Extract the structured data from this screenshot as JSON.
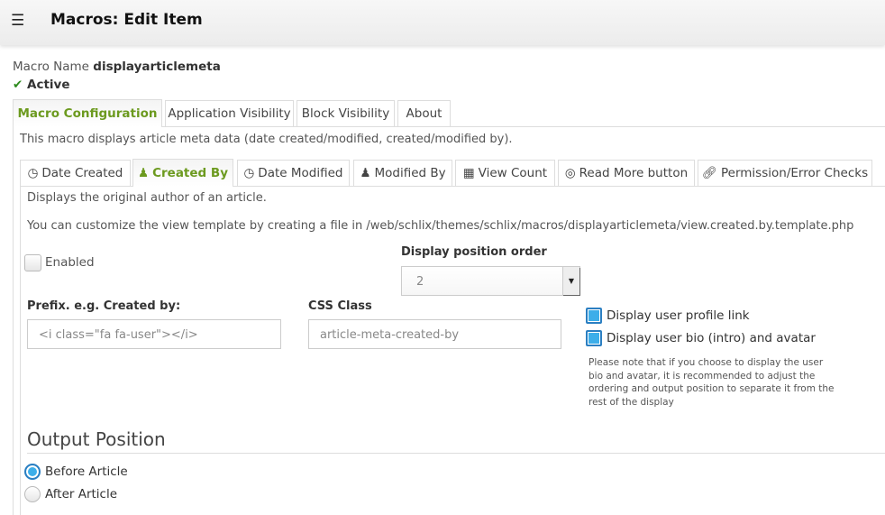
{
  "header": {
    "title": "Macros: Edit Item",
    "menu_icon": "hamburger-icon"
  },
  "macro": {
    "name_label": "Macro Name",
    "name": "displayarticlemeta",
    "status": "Active",
    "status_color": "#2e8b1e"
  },
  "tabs": [
    {
      "label": "Macro Configuration",
      "active": true
    },
    {
      "label": "Application Visibility"
    },
    {
      "label": "Block Visibility"
    },
    {
      "label": "About"
    }
  ],
  "description": "This macro displays article meta data (date created/modified, created/modified by).",
  "subtabs": [
    {
      "label": "Date Created",
      "icon": "clock-icon"
    },
    {
      "label": "Created By",
      "icon": "user-icon",
      "active": true
    },
    {
      "label": "Date Modified",
      "icon": "clock-icon"
    },
    {
      "label": "Modified By",
      "icon": "user-icon"
    },
    {
      "label": "View Count",
      "icon": "calculator-icon"
    },
    {
      "label": "Read More button",
      "icon": "bullseye-icon"
    },
    {
      "label": "Permission/Error Checks",
      "icon": "link-icon"
    }
  ],
  "panel": {
    "intro": "Displays the original author of an article.",
    "hint": "You can customize the view template by creating a file in /web/schlix/themes/schlix/macros/displayarticlemeta/view.created.by.template.php",
    "enabled_label": "Enabled",
    "enabled": false,
    "position_order_label": "Display position order",
    "position_order_value": "2",
    "prefix_label": "Prefix. e.g. Created by:",
    "prefix_value": "<i class=\"fa fa-user\"></i>",
    "css_label": "CSS Class",
    "css_value": "article-meta-created-by",
    "profile_link_label": "Display user profile link",
    "profile_link": true,
    "bio_label": "Display user bio (intro) and avatar",
    "bio": true,
    "note": "Please note that if you choose to display the user bio and avatar, it is recommended to adjust the ordering and output position to separate it from the rest of the display",
    "output_heading": "Output Position",
    "output_options": [
      {
        "label": "Before Article",
        "selected": true
      },
      {
        "label": "After Article",
        "selected": false
      }
    ]
  },
  "accent": "#6c9a1f"
}
